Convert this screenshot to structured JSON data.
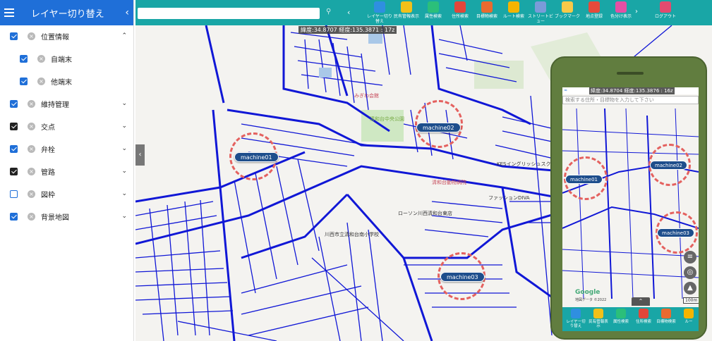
{
  "sidebar": {
    "title": "レイヤー切り替え",
    "collapse_glyph": "‹",
    "layers": [
      {
        "label": "位置情報",
        "checked": true,
        "expand": "⌃"
      },
      {
        "label": "自端末",
        "checked": true,
        "indent": true
      },
      {
        "label": "他端末",
        "checked": true,
        "indent": true
      },
      {
        "label": "維持管理",
        "checked": true,
        "expand": "⌄"
      },
      {
        "label": "交点",
        "checked": true,
        "expand": "⌄"
      },
      {
        "label": "弁栓",
        "checked": true,
        "expand": "⌄"
      },
      {
        "label": "管路",
        "checked": true,
        "expand": "⌄"
      },
      {
        "label": "図枠",
        "checked": false,
        "expand": "⌄"
      },
      {
        "label": "背景地図",
        "checked": true,
        "expand": "⌄"
      }
    ]
  },
  "toolbar": {
    "buttons": [
      {
        "label": "レイヤー切り替え",
        "icon": "layers-icon",
        "color": "#2f8fe0"
      },
      {
        "label": "民有管報表示",
        "icon": "note-icon",
        "color": "#f2c01a"
      },
      {
        "label": "属性検索",
        "icon": "search-icon",
        "color": "#2bbf7a"
      },
      {
        "label": "住所検索",
        "icon": "home-icon",
        "color": "#e2463a"
      },
      {
        "label": "目標物検索",
        "icon": "photo-icon",
        "color": "#e96a2f"
      },
      {
        "label": "ルート検索",
        "icon": "route-icon",
        "color": "#f4b400"
      },
      {
        "label": "ストリートビュー",
        "icon": "streetview-icon",
        "color": "#7a9bd9"
      },
      {
        "label": "ブックマーク",
        "icon": "star-icon",
        "color": "#f7c948"
      },
      {
        "label": "地点登録",
        "icon": "pin-icon",
        "color": "#e64a3b"
      },
      {
        "label": "色分け表示",
        "icon": "palette-icon",
        "color": "#e54fa4"
      }
    ],
    "more_glyph": "›",
    "logout_label": "ログアウト",
    "logout_color": "#e34a6f"
  },
  "map": {
    "coords": "緯度:34.8707 経度:135.3871 : 17z",
    "machines": [
      "machine01",
      "machine02",
      "machine03"
    ],
    "labels": [
      "みぎわ会館",
      "清和台中央公園",
      "川西市立清和台南小学校",
      "KESイングリッシュスクール",
      "清和台動物病院",
      "ファッションDIVA",
      "ローソン川西清和台東店"
    ]
  },
  "phone": {
    "coords": "緯度:34.8704 経度:135.3876 : 16z",
    "search_placeholder": "検索する住所・目標物を入力して下さい",
    "machines": [
      "machine01",
      "machine02",
      "machine03"
    ],
    "google": "Google",
    "attribution": "地図データ ©2022",
    "scale": "100m",
    "buttons": [
      "レイヤー切り替え",
      "民有管報表示",
      "属性検索",
      "住所検索",
      "目標物検索",
      "ルー"
    ]
  }
}
